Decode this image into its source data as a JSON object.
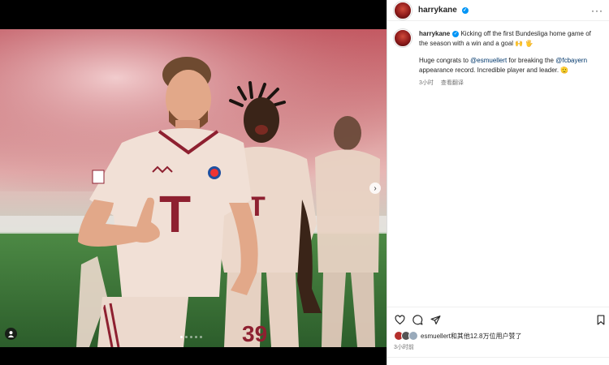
{
  "header": {
    "username": "harrykane",
    "verified": true,
    "more_icon": "more-horizontal-icon"
  },
  "caption": {
    "username": "harrykane",
    "line1": " Kicking off the first Bundesliga home game of the season with a win and a goal 🙌 🖐",
    "p2_before": "Huge congrats to ",
    "p2_mention1": "@esmuellert",
    "p2_middle": " for breaking the ",
    "p2_mention2": "@fcbayern",
    "p2_after": " appearance record. Incredible player and leader. 🫡",
    "time": "3小时",
    "translate": "查看翻译"
  },
  "likes": {
    "text": "esmuellert和其他12.8万位用户赞了"
  },
  "post_time": "3小时前",
  "photo": {
    "jersey_letter": "T",
    "jersey_number": "39",
    "background_colors": [
      "#c96a72",
      "#e8c9c4",
      "#3e7a45"
    ]
  },
  "colors": {
    "accent": "#0095f6",
    "mention": "#00376b",
    "secondary_text": "#737373"
  },
  "carousel": {
    "total": 5,
    "active_index": 0
  }
}
